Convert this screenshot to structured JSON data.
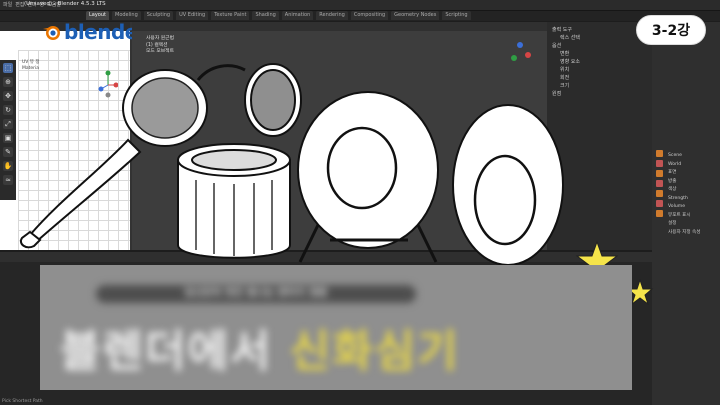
{
  "app": {
    "window_title": "(Unsaved) - Blender 4.5.3 LTS",
    "menus": [
      "파일",
      "편집",
      "렌더",
      "창",
      "도움말"
    ]
  },
  "workspace_tabs": [
    "Layout",
    "Modeling",
    "Sculpting",
    "UV Editing",
    "Texture Paint",
    "Shading",
    "Animation",
    "Rendering",
    "Compositing",
    "Geometry Nodes",
    "Scripting"
  ],
  "active_tab_index": 0,
  "logo": {
    "text": "blender",
    "color": "#1d5fb5"
  },
  "uv_editor": {
    "info_lines": [
      "UV 뷰 정",
      "Materia"
    ]
  },
  "viewport": {
    "info_lines": [
      "사용자 원근법",
      "(1) 컬렉션",
      "모드 오브젝트"
    ]
  },
  "outliner": {
    "rows": [
      "출력 도구",
      "렉스 선택",
      "옵션",
      "변환",
      "영향 요소",
      "위치",
      "회전",
      "크기",
      "원점"
    ]
  },
  "properties": {
    "rows": [
      "Scene",
      "World",
      "표면",
      "방출",
      "색상",
      "Strength",
      "Volume",
      "뷰포트 표시",
      "설정",
      "사용자 지정 속성"
    ]
  },
  "badge": {
    "text": "3-2강"
  },
  "banner": {
    "subtitle": "당신만의 멋진 빛나는 판타지 정원",
    "title_white": "블렌더에서",
    "title_yellow": "신화심기"
  },
  "status_bar": {
    "text": "Pick Shortest Path"
  },
  "colors": {
    "star_fill": "#f5e44a",
    "banner_bg": "#8f8f8f",
    "title_yellow": "#e7d64a"
  }
}
